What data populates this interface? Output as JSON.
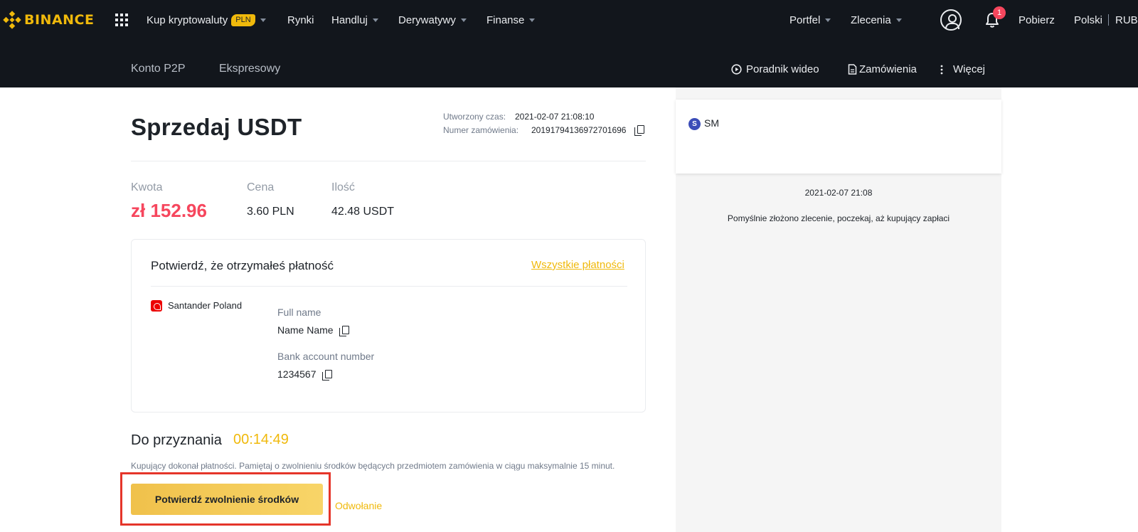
{
  "header": {
    "logo": "BINANCE",
    "nav": [
      {
        "label": "Kup kryptowaluty",
        "badge": "PLN"
      },
      {
        "label": "Rynki"
      },
      {
        "label": "Handluj"
      },
      {
        "label": "Derywatywy"
      },
      {
        "label": "Finanse"
      }
    ],
    "right": {
      "portfolio": "Portfel",
      "orders": "Zlecenia",
      "notifications_count": "1",
      "download": "Pobierz",
      "language": "Polski",
      "currency": "RUB"
    }
  },
  "subnav": {
    "tabs": [
      "Konto P2P",
      "Ekspresowy"
    ],
    "actions": {
      "video": "Poradnik wideo",
      "orders": "Zamówienia",
      "more": "Więcej"
    }
  },
  "order": {
    "title": "Sprzedaj USDT",
    "created_label": "Utworzony czas:",
    "created_value": "2021-02-07 21:08:10",
    "number_label": "Numer zamówienia:",
    "number_value": "20191794136972701696",
    "amount_label": "Kwota",
    "amount_value": "zł 152.96",
    "price_label": "Cena",
    "price_value": "3.60 PLN",
    "qty_label": "Ilość",
    "qty_value": "42.48 USDT"
  },
  "payment": {
    "title": "Potwierdź, że otrzymałeś płatność",
    "all_link": "Wszystkie płatności",
    "bank": "Santander Poland",
    "fullname_label": "Full name",
    "fullname_value": "Name Name",
    "account_label": "Bank account number",
    "account_value": "1234567"
  },
  "release": {
    "label": "Do przyznania",
    "timer": "00:14:49",
    "note": "Kupujący dokonał płatności. Pamiętaj o zwolnieniu środków będących przedmiotem zamówienia w ciągu maksymalnie 15 minut.",
    "confirm_button": "Potwierdź zwolnienie środków",
    "appeal": "Odwołanie"
  },
  "chat": {
    "avatar_letter": "S",
    "name": "SM",
    "time": "2021-02-07 21:08",
    "message": "Pomyślnie złożono zlecenie, poczekaj, aż kupujący zapłaci"
  },
  "colors": {
    "brand": "#f0b90b",
    "nav_bg": "#12161c",
    "sell_red": "#f6465d",
    "highlight": "#e5352a"
  }
}
